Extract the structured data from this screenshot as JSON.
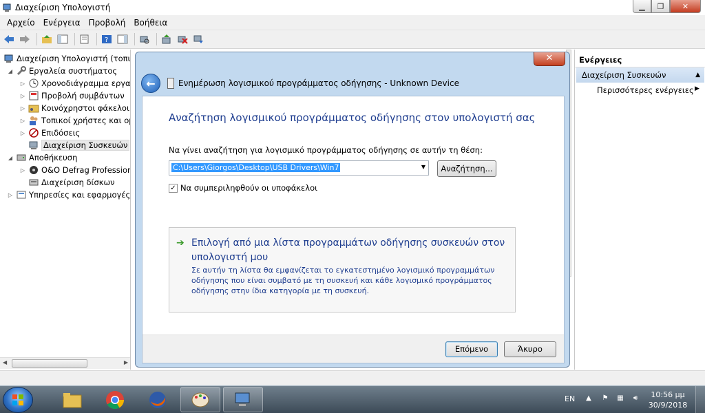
{
  "window": {
    "title": "Διαχείριση Υπολογιστή"
  },
  "menu": [
    "Αρχείο",
    "Ενέργεια",
    "Προβολή",
    "Βοήθεια"
  ],
  "tree": {
    "items": [
      {
        "label": "Διαχείριση Υπολογιστή (τοπικ",
        "level": 0
      },
      {
        "label": "Εργαλεία συστήματος",
        "level": 1
      },
      {
        "label": "Χρονοδιάγραμμα εργασ",
        "level": 2
      },
      {
        "label": "Προβολή συμβάντων",
        "level": 2
      },
      {
        "label": "Κοινόχρηστοι φάκελοι",
        "level": 2
      },
      {
        "label": "Τοπικοί χρήστες και ομ",
        "level": 2
      },
      {
        "label": "Επιδόσεις",
        "level": 2
      },
      {
        "label": "Διαχείριση Συσκευών",
        "level": 2
      },
      {
        "label": "Αποθήκευση",
        "level": 1
      },
      {
        "label": "O&O Defrag Profession",
        "level": 2
      },
      {
        "label": "Διαχείριση δίσκων",
        "level": 2
      },
      {
        "label": "Υπηρεσίες και εφαρμογές",
        "level": 1
      }
    ]
  },
  "dialog": {
    "title": "Ενημέρωση λογισμικού προγράμματος οδήγησης - Unknown Device",
    "close": "✕",
    "heading": "Αναζήτηση λογισμικού προγράμματος οδήγησης στον υπολογιστή σας",
    "search_label": "Να γίνει αναζήτηση για λογισμικό προγράμματος οδήγησης σε αυτήν τη θέση:",
    "path_value": "C:\\Users\\Giorgos\\Desktop\\USB Drivers\\Win7",
    "browse": "Αναζήτηση...",
    "include_subfolders": "Να συμπεριληφθούν οι υποφάκελοι",
    "include_subfolders_checked": true,
    "option_title": "Επιλογή από μια λίστα προγραμμάτων οδήγησης συσκευών στον υπολογιστή μου",
    "option_desc": "Σε αυτήν τη λίστα θα εμφανίζεται το εγκατεστημένο λογισμικό προγραμμάτων οδήγησης που είναι συμβατό με τη συσκευή και κάθε λογισμικό προγράμματος οδήγησης στην ίδια κατηγορία με τη συσκευή.",
    "next": "Επόμενο",
    "cancel": "Άκυρο"
  },
  "actions": {
    "header": "Ενέργειες",
    "section": "Διαχείριση Συσκευών",
    "more": "Περισσότερες ενέργειες"
  },
  "taskbar": {
    "language": "EN",
    "time": "10:56 μμ",
    "date": "30/9/2018"
  }
}
